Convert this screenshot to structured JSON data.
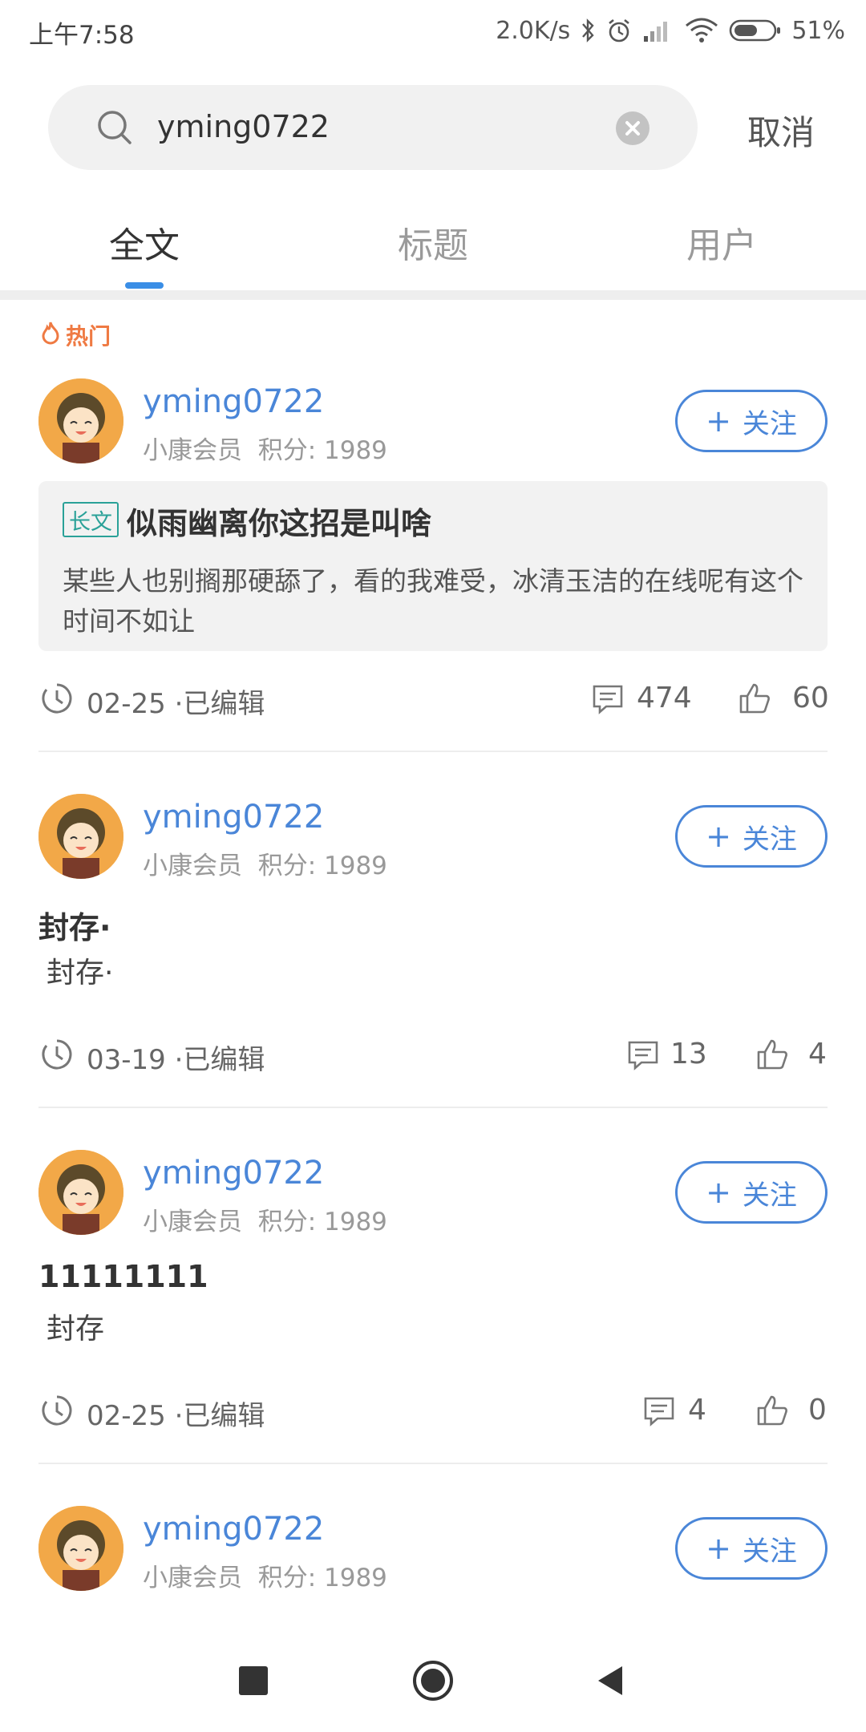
{
  "status_bar": {
    "time": "上午7:58",
    "net_speed": "2.0K/s",
    "battery": "51%"
  },
  "search": {
    "query": "yming0722",
    "cancel_label": "取消"
  },
  "tabs": [
    {
      "label": "全文",
      "active": true
    },
    {
      "label": "标题",
      "active": false
    },
    {
      "label": "用户",
      "active": false
    }
  ],
  "hot_label": "热门",
  "posts": [
    {
      "username": "yming0722",
      "level": "小康会员",
      "points": "积分: 1989",
      "follow_label": "关注",
      "tag": "长文",
      "title": "似雨幽离你这招是叫啥",
      "body": "某些人也别搁那硬舔了，看的我难受，冰清玉洁的在线呢有这个时间不如让",
      "date": "02-25 ·已编辑",
      "comments": "474",
      "likes": "60"
    },
    {
      "username": "yming0722",
      "level": "小康会员",
      "points": "积分: 1989",
      "follow_label": "关注",
      "title": "封存·",
      "body": "封存·",
      "date": "03-19 ·已编辑",
      "comments": "13",
      "likes": "4"
    },
    {
      "username": "yming0722",
      "level": "小康会员",
      "points": "积分: 1989",
      "follow_label": "关注",
      "title": "11111111",
      "body": "封存",
      "date": "02-25 ·已编辑",
      "comments": "4",
      "likes": "0"
    },
    {
      "username": "yming0722",
      "level": "小康会员",
      "points": "积分: 1989",
      "follow_label": "关注"
    }
  ],
  "colors": {
    "accent": "#4a86d8",
    "tab_indicator": "#3a8ee6",
    "hot": "#ef7a43",
    "tag": "#2aa198"
  }
}
